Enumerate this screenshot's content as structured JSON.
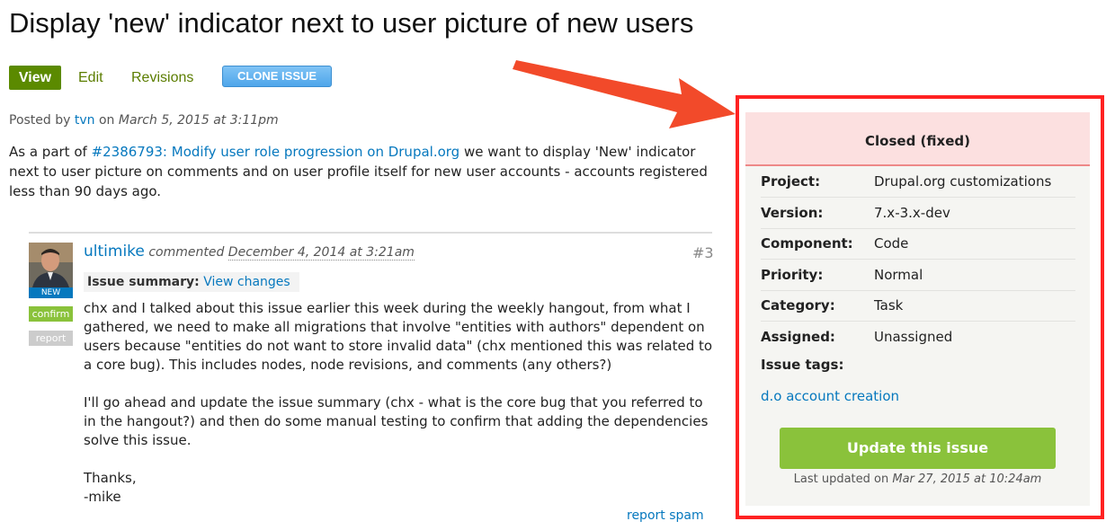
{
  "page": {
    "title": "Display 'new' indicator next to user picture of new users"
  },
  "tabs": {
    "view": "View",
    "edit": "Edit",
    "revisions": "Revisions",
    "clone": "CLONE ISSUE"
  },
  "posted": {
    "prefix": "Posted by",
    "author": "tvn",
    "on": "on",
    "date": "March 5, 2015 at 3:11pm"
  },
  "intro": {
    "before": "As a part of ",
    "link": "#2386793: Modify user role progression on Drupal.org",
    "after": " we want to display 'New' indicator next to user picture on comments and on user profile itself for new user accounts - accounts registered less than 90 days ago."
  },
  "comment": {
    "author": "ultimike",
    "commented": "commented",
    "date": "December 4, 2014 at 3:21am",
    "number": "#3",
    "badge_new": "NEW",
    "badge_confirm": "confirm",
    "badge_report": "report",
    "summary_label": "Issue summary:",
    "summary_link": "View changes",
    "paragraphs": [
      "chx and I talked about this issue earlier this week during the weekly hangout, from what I gathered, we need to make all migrations that involve \"entities with authors\" dependent on users because \"entities do not want to store invalid data\" (chx mentioned this was related to a core bug). This includes nodes, node revisions, and comments (any others?)",
      "I'll go ahead and update the issue summary (chx - what is the core bug that you referred to in the hangout?) and then do some manual testing to confirm that adding the dependencies solve this issue.",
      "Thanks,",
      "-mike"
    ],
    "report_spam": "report spam"
  },
  "sidebar": {
    "status": "Closed (fixed)",
    "rows": [
      {
        "label": "Project:",
        "value": "Drupal.org customizations"
      },
      {
        "label": "Version:",
        "value": "7.x-3.x-dev"
      },
      {
        "label": "Component:",
        "value": "Code"
      },
      {
        "label": "Priority:",
        "value": "Normal"
      },
      {
        "label": "Category:",
        "value": "Task"
      },
      {
        "label": "Assigned:",
        "value": "Unassigned"
      }
    ],
    "tags_label": "Issue tags:",
    "tag": "d.o account creation",
    "update_button": "Update this issue",
    "last_updated_prefix": "Last updated on",
    "last_updated_date": "Mar 27, 2015 at 10:24am"
  },
  "colors": {
    "highlight_border": "#ff2222",
    "arrow": "#f24a2a",
    "link": "#0678be",
    "green": "#8ac23b",
    "status_bg": "#fce0e0"
  }
}
